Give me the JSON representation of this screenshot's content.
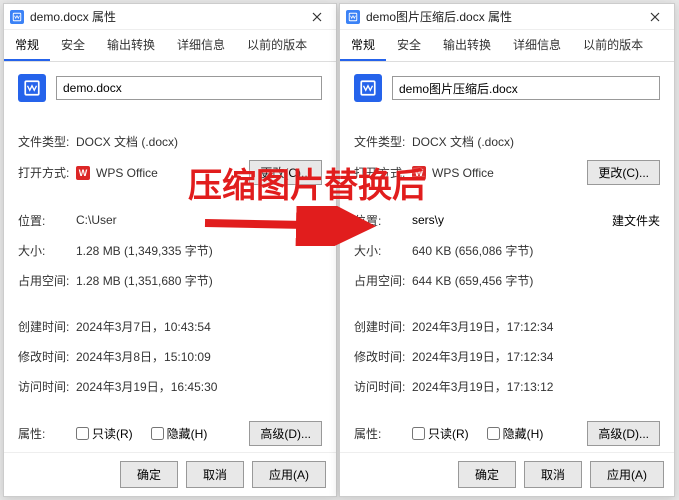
{
  "annotation": "压缩图片替换后",
  "tabs": {
    "general": "常规",
    "security": "安全",
    "output": "输出转换",
    "details": "详细信息",
    "previous": "以前的版本"
  },
  "labels": {
    "file_type": "文件类型:",
    "open_with": "打开方式:",
    "location": "位置:",
    "size": "大小:",
    "disk_size": "占用空间:",
    "created": "创建时间:",
    "modified": "修改时间:",
    "accessed": "访问时间:",
    "attributes": "属性:",
    "readonly": "只读(R)",
    "hidden": "隐藏(H)",
    "change": "更改(C)...",
    "advanced": "高级(D)..."
  },
  "buttons": {
    "ok": "确定",
    "cancel": "取消",
    "apply": "应用(A)"
  },
  "left": {
    "title": "demo.docx 属性",
    "filename": "demo.docx",
    "file_type": "DOCX 文档 (.docx)",
    "open_with": "WPS Office",
    "location": "C:\\User",
    "size": "1.28 MB (1,349,335 字节)",
    "disk_size": "1.28 MB (1,351,680 字节)",
    "created": "2024年3月7日，10:43:54",
    "modified": "2024年3月8日，15:10:09",
    "accessed": "2024年3月19日，16:45:30"
  },
  "right": {
    "title": "demo图片压缩后.docx 属性",
    "filename": "demo图片压缩后.docx",
    "file_type": "DOCX 文档 (.docx)",
    "open_with": "WPS Office",
    "location_prefix": "sers\\y",
    "location_suffix": "建文件夹",
    "size": "640 KB (656,086 字节)",
    "disk_size": "644 KB (659,456 字节)",
    "created": "2024年3月19日，17:12:34",
    "modified": "2024年3月19日，17:12:34",
    "accessed": "2024年3月19日，17:13:12"
  }
}
